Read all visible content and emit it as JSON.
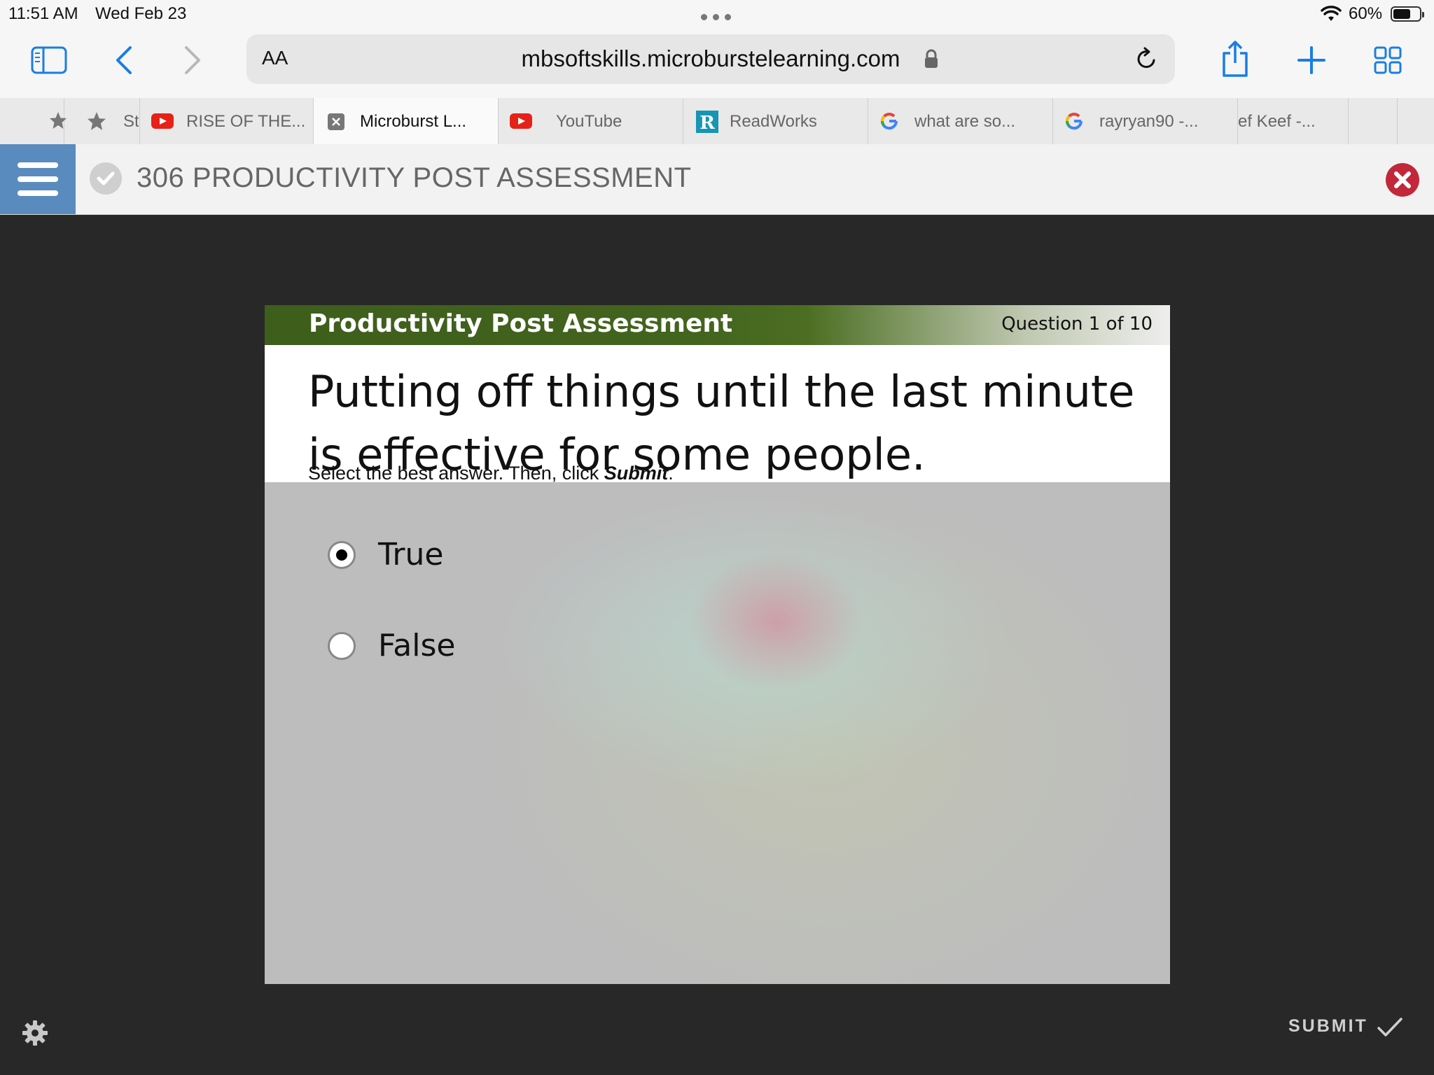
{
  "status_bar": {
    "time": "11:51 AM",
    "date": "Wed Feb 23",
    "battery_percent": "60%",
    "battery_level": 0.6
  },
  "browser": {
    "url": "mbsoftskills.microburstelearning.com",
    "reader_label": "AA",
    "icons": [
      "sidebar-icon",
      "back-icon",
      "forward-icon",
      "lock-icon",
      "reload-icon",
      "share-icon",
      "new-tab-icon",
      "tab-overview-icon"
    ],
    "tabs": [
      {
        "label": "St",
        "favicon": "star-icon",
        "active": false
      },
      {
        "label": "RISE OF THE...",
        "favicon": "youtube-icon",
        "active": false
      },
      {
        "label": "Microburst L...",
        "favicon": "close-icon",
        "active": true
      },
      {
        "label": "YouTube",
        "favicon": "youtube-icon",
        "active": false
      },
      {
        "label": "ReadWorks",
        "favicon": "readworks-icon",
        "active": false
      },
      {
        "label": "what are so...",
        "favicon": "google-icon",
        "active": false
      },
      {
        "label": "rayryan90 -...",
        "favicon": "google-icon",
        "active": false
      },
      {
        "label": "ef Keef -...",
        "favicon": "",
        "active": false
      }
    ]
  },
  "course": {
    "title": "306 PRODUCTIVITY POST ASSESSMENT"
  },
  "slide": {
    "header_title": "Productivity Post Assessment",
    "question_number": "Question 1 of 10",
    "question": "Putting off things until the last minute is effective for some people.",
    "instruction_prefix": "Select the best answer. Then, click ",
    "instruction_emphasis": "Submit",
    "instruction_suffix": ".",
    "options": [
      {
        "label": "True",
        "selected": true
      },
      {
        "label": "False",
        "selected": false
      }
    ]
  },
  "footer": {
    "submit_label": "SUBMIT",
    "icons": [
      "gear-icon",
      "checkmark-icon"
    ]
  },
  "colors": {
    "menu_button": "#5a8bbf",
    "close_button": "#c2273a",
    "slide_header_green": "#3e5e1c",
    "ios_blue": "#1a7de3"
  }
}
